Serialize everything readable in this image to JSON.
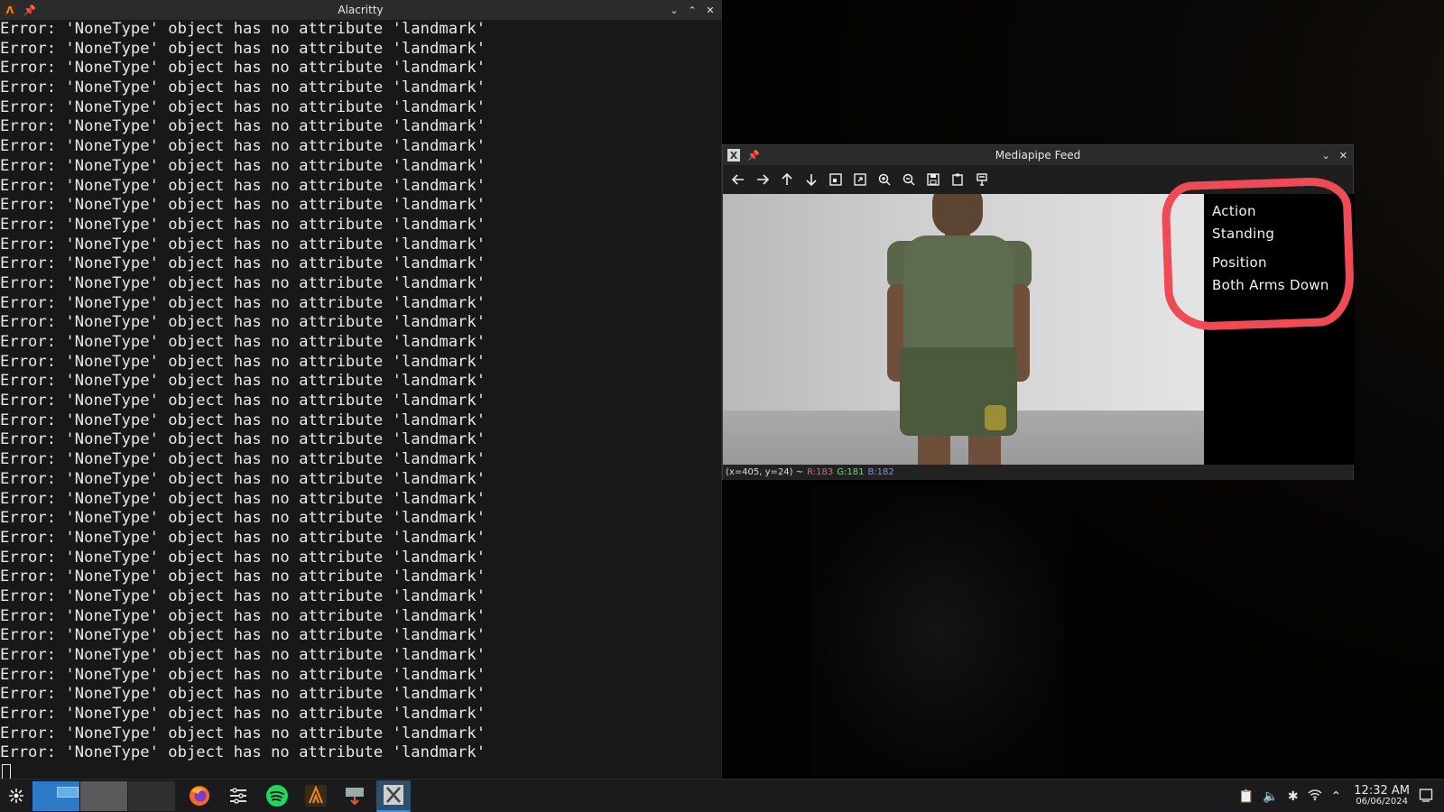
{
  "terminal": {
    "title": "Alacritty",
    "app_icon_label": "Λ",
    "lines": [
      "Error: 'NoneType' object has no attribute 'landmark'",
      "Error: 'NoneType' object has no attribute 'landmark'",
      "Error: 'NoneType' object has no attribute 'landmark'",
      "Error: 'NoneType' object has no attribute 'landmark'",
      "Error: 'NoneType' object has no attribute 'landmark'",
      "Error: 'NoneType' object has no attribute 'landmark'",
      "Error: 'NoneType' object has no attribute 'landmark'",
      "Error: 'NoneType' object has no attribute 'landmark'",
      "Error: 'NoneType' object has no attribute 'landmark'",
      "Error: 'NoneType' object has no attribute 'landmark'",
      "Error: 'NoneType' object has no attribute 'landmark'",
      "Error: 'NoneType' object has no attribute 'landmark'",
      "Error: 'NoneType' object has no attribute 'landmark'",
      "Error: 'NoneType' object has no attribute 'landmark'",
      "Error: 'NoneType' object has no attribute 'landmark'",
      "Error: 'NoneType' object has no attribute 'landmark'",
      "Error: 'NoneType' object has no attribute 'landmark'",
      "Error: 'NoneType' object has no attribute 'landmark'",
      "Error: 'NoneType' object has no attribute 'landmark'",
      "Error: 'NoneType' object has no attribute 'landmark'",
      "Error: 'NoneType' object has no attribute 'landmark'",
      "Error: 'NoneType' object has no attribute 'landmark'",
      "Error: 'NoneType' object has no attribute 'landmark'",
      "Error: 'NoneType' object has no attribute 'landmark'",
      "Error: 'NoneType' object has no attribute 'landmark'",
      "Error: 'NoneType' object has no attribute 'landmark'",
      "Error: 'NoneType' object has no attribute 'landmark'",
      "Error: 'NoneType' object has no attribute 'landmark'",
      "Error: 'NoneType' object has no attribute 'landmark'",
      "Error: 'NoneType' object has no attribute 'landmark'",
      "Error: 'NoneType' object has no attribute 'landmark'",
      "Error: 'NoneType' object has no attribute 'landmark'",
      "Error: 'NoneType' object has no attribute 'landmark'",
      "Error: 'NoneType' object has no attribute 'landmark'",
      "Error: 'NoneType' object has no attribute 'landmark'",
      "Error: 'NoneType' object has no attribute 'landmark'",
      "Error: 'NoneType' object has no attribute 'landmark'",
      "Error: 'NoneType' object has no attribute 'landmark'"
    ]
  },
  "mediapipe": {
    "title": "Mediapipe Feed",
    "toolbar_icons": [
      "arrow-left-icon",
      "arrow-right-icon",
      "arrow-up-icon",
      "arrow-down-icon",
      "zoom-fit-icon",
      "zoom-original-icon",
      "zoom-in-icon",
      "zoom-out-icon",
      "save-icon",
      "copy-icon",
      "properties-icon"
    ],
    "overlay": {
      "action_label": "Action",
      "action_value": "Standing",
      "position_label": "Position",
      "position_value": "Both Arms Down",
      "highlight_color": "#ef4b56"
    },
    "status": {
      "coords": "(x=405, y=24) ~",
      "r": "R:183",
      "g": "G:181",
      "b": "B:182"
    }
  },
  "taskbar": {
    "apps": [
      "firefox-icon",
      "system-settings-icon",
      "spotify-icon",
      "alacritty-icon",
      "file-transfer-icon",
      "x-window-icon"
    ],
    "active_app": "x-window-icon",
    "clock_time": "12:32 AM",
    "clock_date": "06/06/2024",
    "accent_color": "#2d7bc6"
  }
}
